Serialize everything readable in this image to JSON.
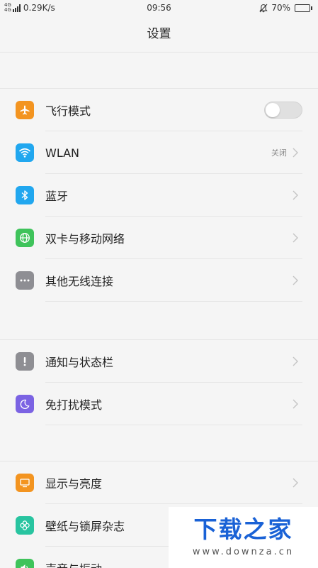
{
  "status": {
    "network_top": "4G",
    "network_bottom": "4G",
    "speed": "0.29K/s",
    "time": "09:56",
    "battery_text": "70%",
    "battery_level": 0.7
  },
  "header": {
    "title": "设置"
  },
  "groups": [
    {
      "items": [
        {
          "label": "飞行模式",
          "control": "toggle",
          "toggle_on": false,
          "icon": "airplane-icon",
          "color": "#f39420"
        },
        {
          "label": "WLAN",
          "value": "关闭",
          "icon": "wifi-icon",
          "color": "#21a7ef"
        },
        {
          "label": "蓝牙",
          "icon": "bluetooth-icon",
          "color": "#21a7ef"
        },
        {
          "label": "双卡与移动网络",
          "icon": "globe-icon",
          "color": "#3fc35b"
        },
        {
          "label": "其他无线连接",
          "icon": "more-icon",
          "color": "#8e8e93"
        }
      ]
    },
    {
      "items": [
        {
          "label": "通知与状态栏",
          "icon": "exclamation-icon",
          "color": "#8e8e93"
        },
        {
          "label": "免打扰模式",
          "icon": "moon-icon",
          "color": "#7b63e3"
        }
      ]
    },
    {
      "items": [
        {
          "label": "显示与亮度",
          "icon": "display-icon",
          "color": "#f39420"
        },
        {
          "label": "壁纸与锁屏杂志",
          "icon": "flower-icon",
          "color": "#28c4a0"
        },
        {
          "label": "声音与振动",
          "icon": "speaker-icon",
          "color": "#3fc35b"
        }
      ]
    }
  ],
  "watermark": {
    "title": "下载之家",
    "url": "www.downza.cn"
  }
}
